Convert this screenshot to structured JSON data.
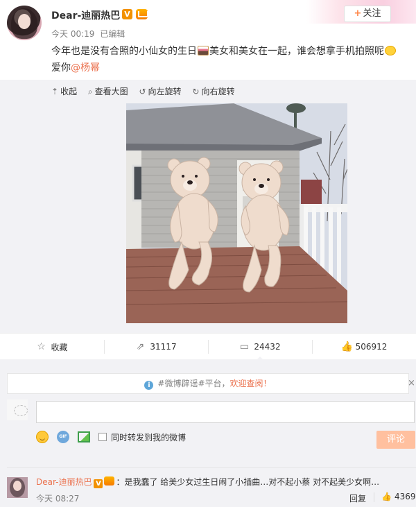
{
  "post": {
    "username": "Dear-迪丽热巴",
    "verified_badge": "V",
    "time": "今天 00:19",
    "edited": "已编辑",
    "text_part1": "今年也是没有合照的小仙女的生日",
    "text_part2": "美女和美女在一起，谁会想拿手机拍照呢",
    "text_part3": "爱你",
    "mention": "@杨幂",
    "follow_label": "关注",
    "follow_plus": "+"
  },
  "media_tools": [
    {
      "icon": "⇡",
      "label": "收起"
    },
    {
      "icon": "⌕",
      "label": "查看大图"
    },
    {
      "icon": "↺",
      "label": "向左旋转"
    },
    {
      "icon": "↻",
      "label": "向右旋转"
    }
  ],
  "actions": {
    "favorite": "收藏",
    "repost_count": "31117",
    "comment_count": "24432",
    "like_count": "506912"
  },
  "comment_box": {
    "notice_prefix": "#微博辟谣#平台，",
    "notice_link": "欢迎查阅！",
    "close": "×",
    "gif_label": "GIF",
    "repost_option": "同时转发到我的微博",
    "submit": "评论"
  },
  "comment": {
    "user": "Dear-迪丽热巴",
    "badge": "V",
    "text": "：是我蠢了 给美少女过生日闹了小插曲…对不起小蔡 对不起美少女啊…",
    "time": "今天 08:27",
    "reply": "回复",
    "likes": "4369"
  },
  "colors": {
    "accent": "#eb7350",
    "follow_plus": "#ff8140",
    "submit_bg": "#ffc09f",
    "bg_gray": "#f2f2f5"
  }
}
